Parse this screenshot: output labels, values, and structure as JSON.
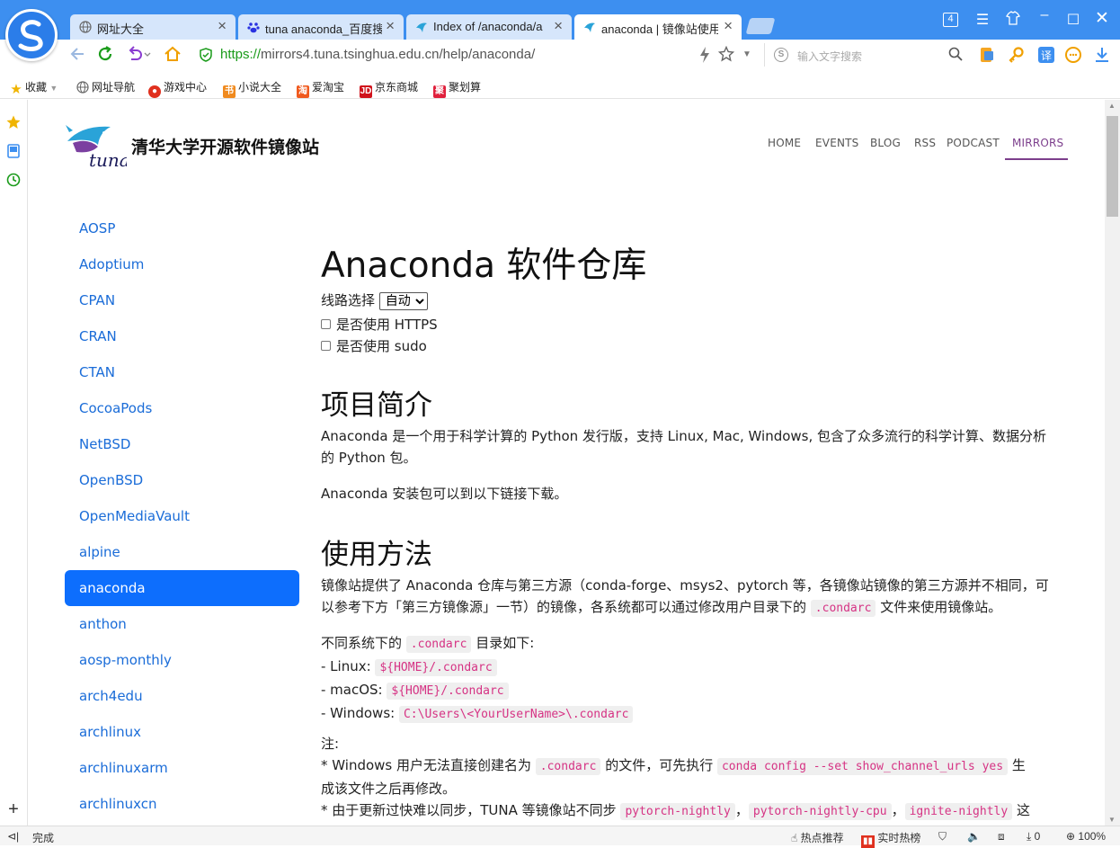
{
  "browser": {
    "tabs": [
      {
        "title": "网址大全",
        "icon": "globe-icon"
      },
      {
        "title": "tuna anaconda_百度搜",
        "icon": "baidu-icon"
      },
      {
        "title": "Index of /anaconda/a",
        "icon": "tuna-icon"
      },
      {
        "title": "anaconda | 镜像站使用",
        "icon": "tuna-icon",
        "active": true
      }
    ],
    "tab_count": "4",
    "url_scheme": "https://",
    "url_host": "mirrors4.tuna.tsinghua.edu.cn",
    "url_path": "/help/anaconda/",
    "search_placeholder": "输入文字搜索",
    "bookmarks": [
      {
        "label": "收藏",
        "icon": "star-icon"
      },
      {
        "label": "网址导航",
        "icon": "globe-icon"
      },
      {
        "label": "游戏中心",
        "icon": "game-icon"
      },
      {
        "label": "小说大全",
        "icon": "book-icon"
      },
      {
        "label": "爱淘宝",
        "icon": "taobao-icon"
      },
      {
        "label": "京东商城",
        "icon": "jd-icon"
      },
      {
        "label": "聚划算",
        "icon": "juhuasuan-icon"
      }
    ],
    "status": {
      "text": "完成",
      "hot_recommend": "热点推荐",
      "realtime_hot": "实时热榜",
      "download_count": "0",
      "zoom": "100%"
    },
    "colors": {
      "chrome": "#3d8ff0",
      "accent_purple": "#7c3e8c",
      "link": "#1a6cd8",
      "active_bg": "#0d6efd"
    }
  },
  "site": {
    "title": "清华大学开源软件镜像站",
    "logo_text": "tuna",
    "nav": [
      "HOME",
      "EVENTS",
      "BLOG",
      "RSS",
      "PODCAST",
      "MIRRORS"
    ],
    "active_nav": "MIRRORS"
  },
  "sidebar": {
    "items": [
      "AOSP",
      "Adoptium",
      "CPAN",
      "CRAN",
      "CTAN",
      "CocoaPods",
      "NetBSD",
      "OpenBSD",
      "OpenMediaVault",
      "alpine",
      "anaconda",
      "anthon",
      "aosp-monthly",
      "arch4edu",
      "archlinux",
      "archlinuxarm",
      "archlinuxcn"
    ],
    "active": "anaconda"
  },
  "content": {
    "title": "Anaconda 软件仓库",
    "route_label": "线路选择",
    "route_value": "自动",
    "https_label": "是否使用 HTTPS",
    "sudo_label": "是否使用 sudo",
    "intro_heading": "项目简介",
    "intro_p1a": "Anaconda 是一个用于科学计算的 Python 发行版，支持 Linux, Mac, Windows, 包含了众多流行的科学计算、数据分析",
    "intro_p1b": "的 Python 包。",
    "intro_p2": "Anaconda 安装包可以到以下链接下载。",
    "usage_heading": "使用方法",
    "usage_p1a": "镜像站提供了 Anaconda 仓库与第三方源（conda-forge、msys2、pytorch 等，各镜像站镜像的第三方源并不相同，可",
    "usage_p1b": "以参考下方「第三方镜像源」一节）的镜像，各系统都可以通过修改用户目录下的",
    "usage_p1c": "文件来使用镜像站。",
    "condarc": ".condarc",
    "dirs_intro_a": "不同系统下的",
    "dirs_intro_b": "目录如下:",
    "linux_label": "- Linux:",
    "linux_path": "${HOME}/.condarc",
    "macos_label": "- macOS:",
    "macos_path": "${HOME}/.condarc",
    "windows_label": "- Windows:",
    "windows_path": "C:\\Users\\<YourUserName>\\.condarc",
    "note_label": "注:",
    "note1a": "* Windows 用户无法直接创建名为",
    "note1b": "的文件，可先执行",
    "note1_cmd": "conda config --set show_channel_urls yes",
    "note1c": "生",
    "note1d": "成该文件之后再修改。",
    "note2a": "* 由于更新过快难以同步，TUNA 等镜像站不同步",
    "note2_c1": "pytorch-nightly",
    "note2_c2": "pytorch-nightly-cpu",
    "note2_c3": "ignite-nightly",
    "note2b": "这",
    "comma": "，"
  }
}
